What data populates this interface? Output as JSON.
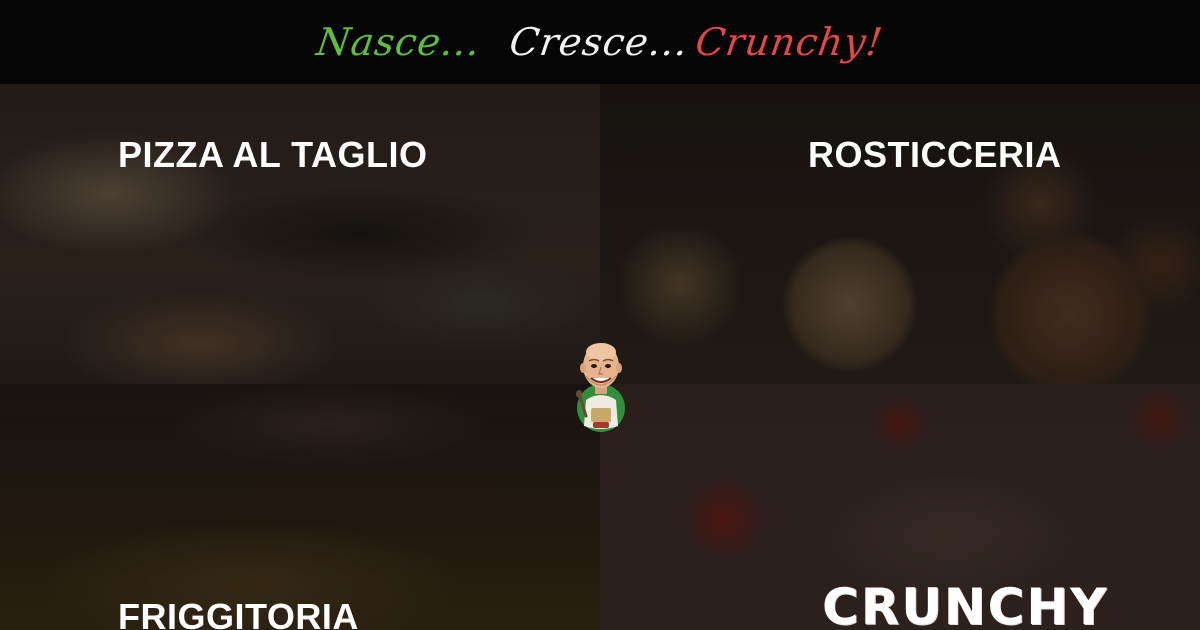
{
  "header": {
    "tagline": [
      "Nasce...",
      "Cresce...",
      "Crunchy!"
    ]
  },
  "panels": [
    {
      "label": "PIZZA AL TAGLIO"
    },
    {
      "label": "ROSTICCERIA"
    },
    {
      "label": "FRIGGITORIA"
    },
    {
      "label": "CRUNCHY"
    }
  ],
  "colors": {
    "italian_green": "#5fbe3c",
    "white": "#f2f2f2",
    "italian_red": "#e3474a",
    "header_bg": "#050505"
  },
  "icons": {
    "mascot": "chef-mascot-icon"
  }
}
